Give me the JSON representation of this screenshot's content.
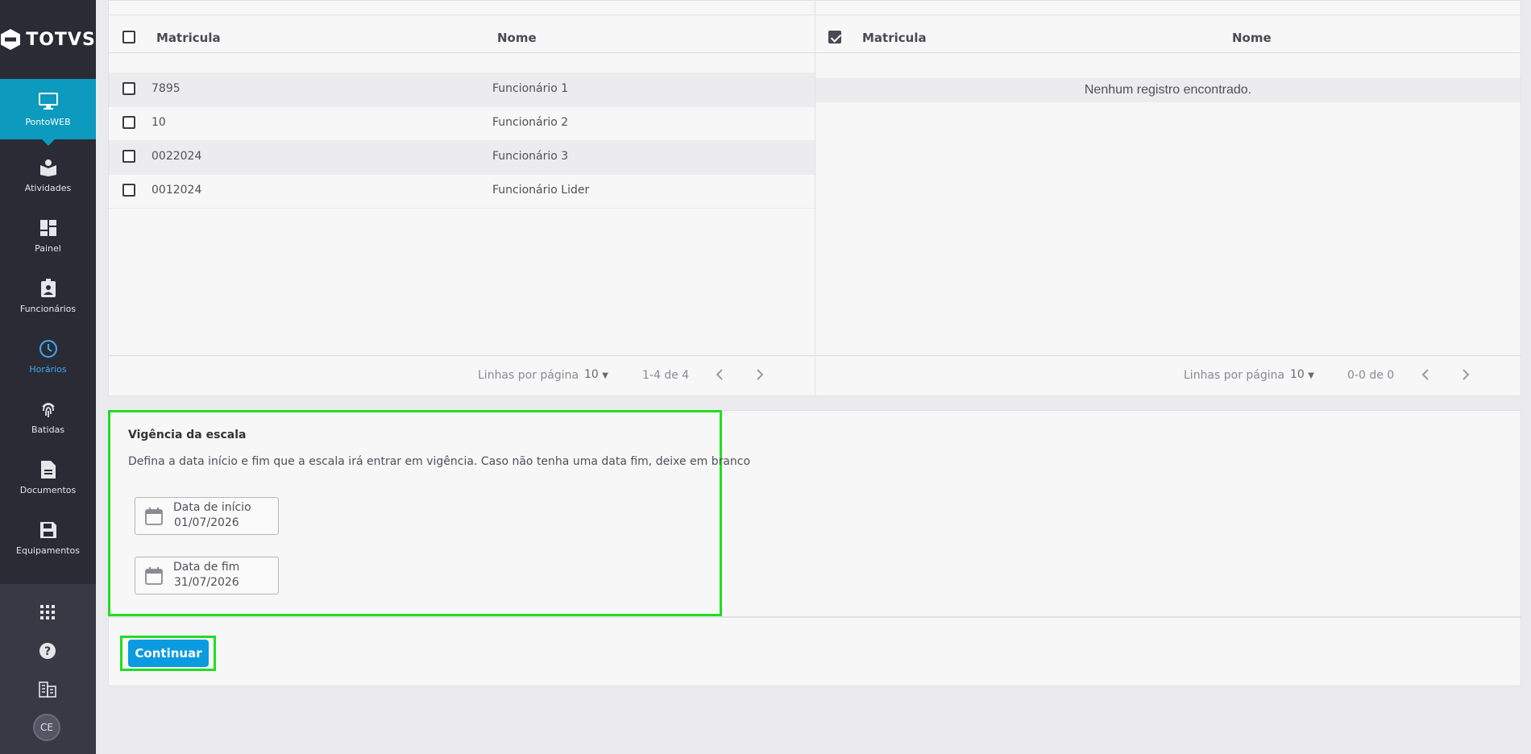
{
  "brand": {
    "logo_text": "TOTVS"
  },
  "sidebar": {
    "items": [
      {
        "label": "PontoWEB",
        "icon": "monitor-icon"
      },
      {
        "label": "Atividades",
        "icon": "book-user-icon"
      },
      {
        "label": "Painel",
        "icon": "dashboard-icon"
      },
      {
        "label": "Funcionários",
        "icon": "badge-icon"
      },
      {
        "label": "Horários",
        "icon": "clock-icon"
      },
      {
        "label": "Batidas",
        "icon": "fingerprint-icon"
      },
      {
        "label": "Documentos",
        "icon": "document-icon"
      },
      {
        "label": "Equipamentos",
        "icon": "floppy-icon"
      }
    ],
    "bottom_icons": [
      "apps-grid-icon",
      "help-icon",
      "building-icon"
    ],
    "avatar_initials": "CE"
  },
  "left_table": {
    "headers": {
      "matricula": "Matricula",
      "nome": "Nome"
    },
    "rows": [
      {
        "matricula": "7895",
        "nome": "Funcionário 1"
      },
      {
        "matricula": "10",
        "nome": "Funcionário 2"
      },
      {
        "matricula": "0022024",
        "nome": "Funcionário 3"
      },
      {
        "matricula": "0012024",
        "nome": "Funcionário Lider"
      }
    ],
    "footer": {
      "rows_per_page_label": "Linhas por página",
      "rows_per_page": "10",
      "range": "1-4 de 4"
    }
  },
  "right_table": {
    "headers": {
      "matricula": "Matricula",
      "nome": "Nome"
    },
    "empty_message": "Nenhum registro encontrado.",
    "footer": {
      "rows_per_page_label": "Linhas por página",
      "rows_per_page": "10",
      "range": "0-0 de 0"
    }
  },
  "vigencia": {
    "title": "Vigência da escala",
    "description": "Defina a data início e fim que a escala irá entrar em vigência. Caso não tenha uma data fim, deixe em branco",
    "start": {
      "label": "Data de início",
      "value": "01/07/2026"
    },
    "end": {
      "label": "Data de fim",
      "value": "31/07/2026"
    }
  },
  "actions": {
    "continue_label": "Continuar"
  },
  "colors": {
    "sidebar": "#2b2b36",
    "active": "#0c9abe",
    "highlight_box": "#22dd22",
    "primary_button": "#0a9be0"
  }
}
